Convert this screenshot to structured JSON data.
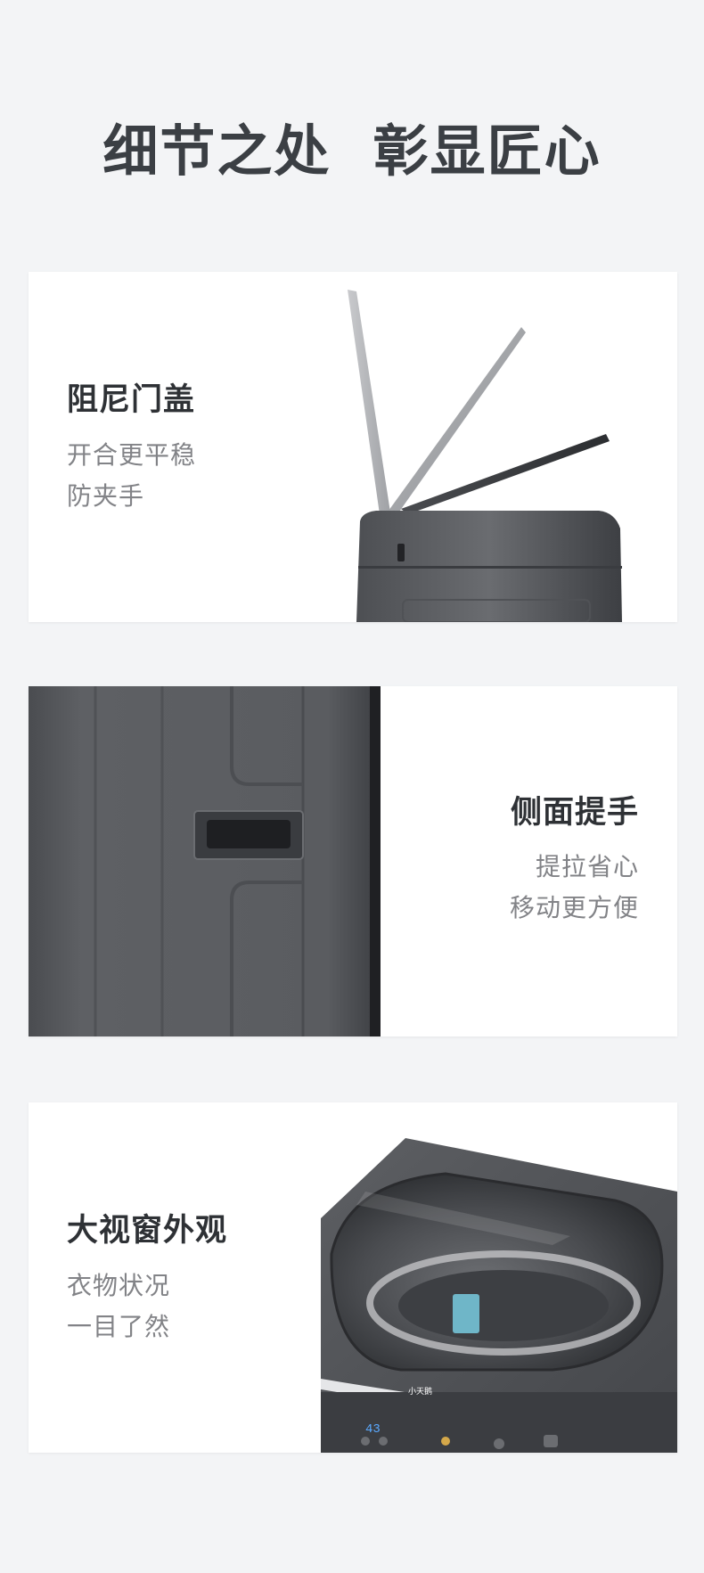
{
  "header": {
    "title": "细节之处  彰显匠心"
  },
  "features": [
    {
      "title": "阻尼门盖",
      "desc_lines": [
        "开合更平稳",
        "防夹手"
      ]
    },
    {
      "title": "侧面提手",
      "desc_lines": [
        "提拉省心",
        "移动更方便"
      ]
    },
    {
      "title": "大视窗外观",
      "desc_lines": [
        "衣物状况",
        "一目了然"
      ]
    }
  ],
  "product_label": {
    "display_digits": "43",
    "brand": "小天鹅"
  },
  "colors": {
    "background": "#f3f4f6",
    "card": "#ffffff",
    "title": "#3b3f44",
    "feature_title": "#2e3135",
    "feature_desc": "#828387",
    "machine_body": "#5b5d61",
    "display_accent": "#5aa9ff"
  }
}
